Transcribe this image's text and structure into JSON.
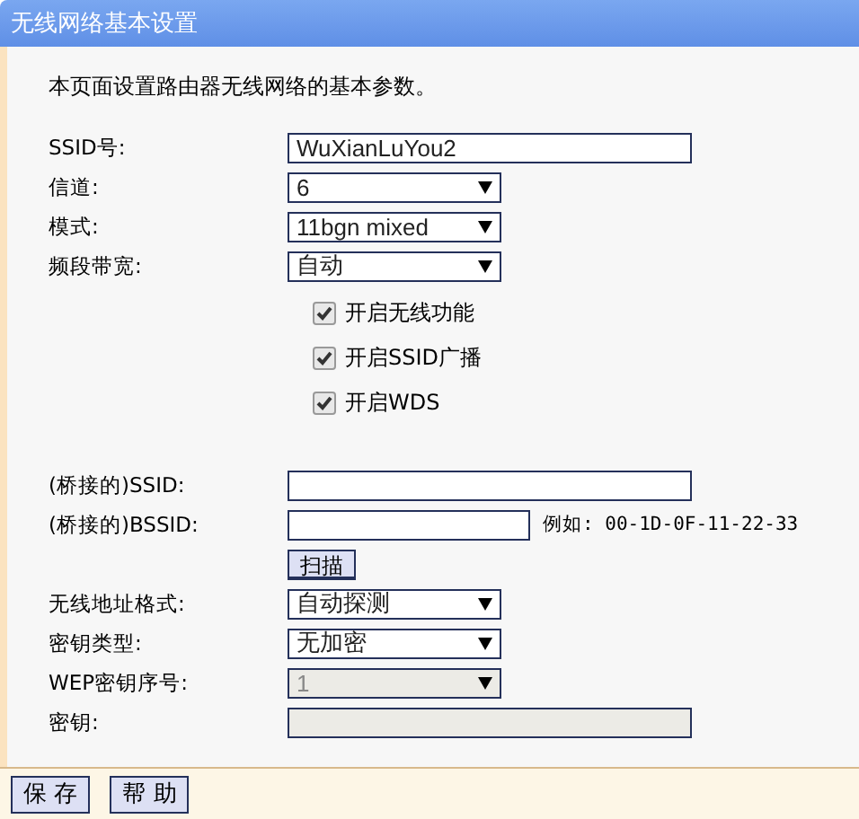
{
  "title": "无线网络基本设置",
  "intro": "本页面设置路由器无线网络的基本参数。",
  "basic_fields": [
    {
      "kind": "text",
      "label": "SSID号:",
      "value": "WuXianLuYou2",
      "disabled": false
    },
    {
      "kind": "select",
      "label": "信道:",
      "value": "6",
      "disabled": false
    },
    {
      "kind": "select",
      "label": "模式:",
      "value": "11bgn mixed",
      "disabled": false
    },
    {
      "kind": "select",
      "label": "频段带宽:",
      "value": "自动",
      "disabled": false
    }
  ],
  "checkboxes": [
    {
      "label": "开启无线功能",
      "checked": true
    },
    {
      "label": "开启SSID广播",
      "checked": true
    },
    {
      "label": "开启WDS",
      "checked": true
    }
  ],
  "wds_fields": [
    {
      "kind": "text",
      "label": "(桥接的)SSID:",
      "disabled": false
    },
    {
      "kind": "text",
      "label": "(桥接的)BSSID:",
      "disabled": false,
      "hint": "例如: 00-1D-0F-11-22-33"
    },
    {
      "kind": "button",
      "label": "扫描"
    },
    {
      "kind": "select",
      "label": "无线地址格式:",
      "value": "自动探测",
      "disabled": false
    },
    {
      "kind": "select",
      "label": "密钥类型:",
      "value": "无加密",
      "disabled": false
    },
    {
      "kind": "select",
      "label": "WEP密钥序号:",
      "value": "1",
      "disabled": true
    },
    {
      "kind": "text",
      "label": "密钥:",
      "disabled": true
    }
  ],
  "buttons": [
    "保 存",
    "帮 助"
  ]
}
